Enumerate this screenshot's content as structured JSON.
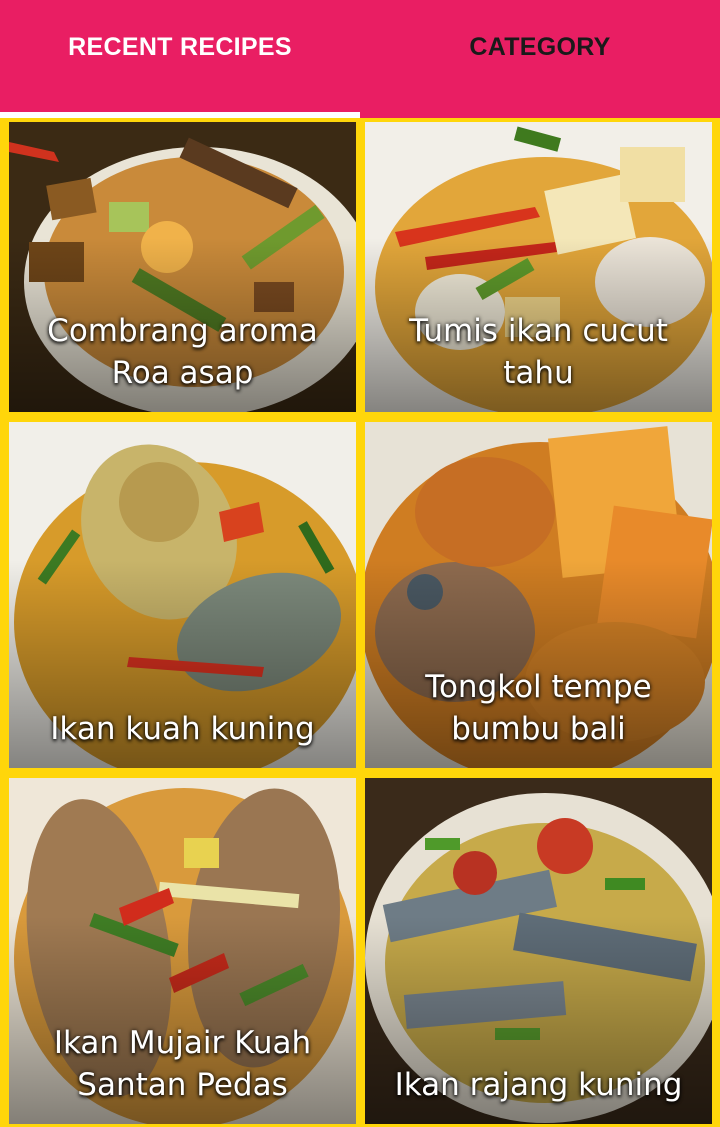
{
  "tabs": [
    {
      "label": "RECENT RECIPES",
      "selected": true
    },
    {
      "label": "CATEGORY",
      "selected": false
    }
  ],
  "colors": {
    "accent": "#e91e63",
    "grid_background": "#ffd60a",
    "tab_active_text": "#ffffff",
    "tab_inactive_text": "#1a1a1a"
  },
  "recipes": [
    {
      "title": "Combrang aroma Roa asap"
    },
    {
      "title": "Tumis ikan cucut tahu"
    },
    {
      "title": "Ikan kuah kuning"
    },
    {
      "title": "Tongkol tempe bumbu bali"
    },
    {
      "title": "Ikan Mujair Kuah Santan Pedas"
    },
    {
      "title": "Ikan rajang kuning"
    }
  ]
}
